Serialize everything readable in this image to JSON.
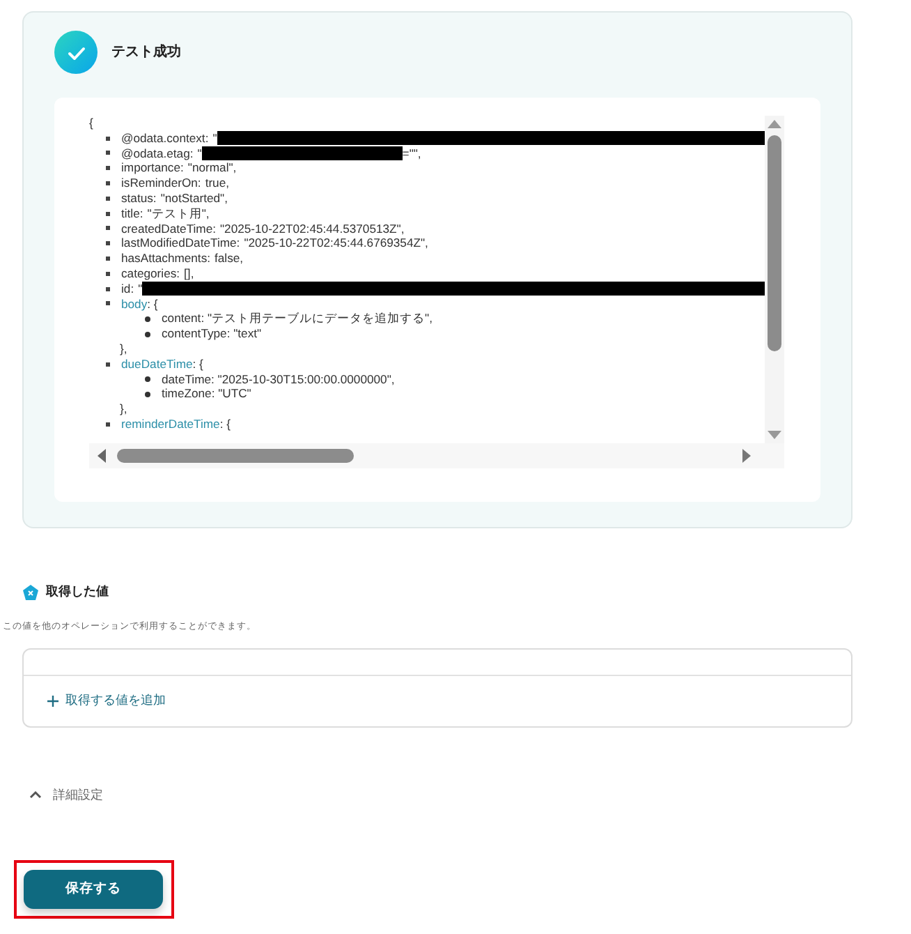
{
  "test_result": {
    "title": "テスト成功",
    "success": true,
    "json_lines": [
      {
        "kind": "brace",
        "text": "{"
      },
      {
        "kind": "item",
        "key": "@odata.context:",
        "value": "\"",
        "redacted": true
      },
      {
        "kind": "item",
        "key": "@odata.etag:",
        "value": "\"",
        "redacted": true,
        "after": "=\"\","
      },
      {
        "kind": "item",
        "key": "importance:",
        "value": "\"normal\","
      },
      {
        "kind": "item",
        "key": "isReminderOn:",
        "value": "true,"
      },
      {
        "kind": "item",
        "key": "status:",
        "value": "\"notStarted\","
      },
      {
        "kind": "item",
        "key": "title:",
        "value": "\"テスト用\","
      },
      {
        "kind": "item",
        "key": "createdDateTime:",
        "value": "\"2025-10-22T02:45:44.5370513Z\","
      },
      {
        "kind": "item",
        "key": "lastModifiedDateTime:",
        "value": "\"2025-10-22T02:45:44.6769354Z\","
      },
      {
        "kind": "item",
        "key": "hasAttachments:",
        "value": "false,"
      },
      {
        "kind": "item",
        "key": "categories:",
        "value": "[],"
      },
      {
        "kind": "item",
        "key": "id:",
        "value": "\"",
        "redacted": true
      },
      {
        "kind": "object",
        "key": "body",
        "value": ": {",
        "children": [
          {
            "text": "content: \"テスト用テーブルにデータを追加する\","
          },
          {
            "text": "contentType: \"text\""
          }
        ],
        "close": "},"
      },
      {
        "kind": "object",
        "key": "dueDateTime",
        "value": ": {",
        "children": [
          {
            "text": "dateTime: \"2025-10-30T15:00:00.0000000\","
          },
          {
            "text": "timeZone: \"UTC\""
          }
        ],
        "close": "},"
      },
      {
        "kind": "object",
        "key": "reminderDateTime",
        "value": ": {"
      }
    ]
  },
  "acquired_values": {
    "title": "取得した値",
    "description": "この値を他のオペレーションで利用することができます。",
    "add_button": "取得する値を追加"
  },
  "advanced_settings": {
    "label": "詳細設定",
    "expanded": true
  },
  "save_button": {
    "label": "保存する",
    "highlighted": true
  }
}
